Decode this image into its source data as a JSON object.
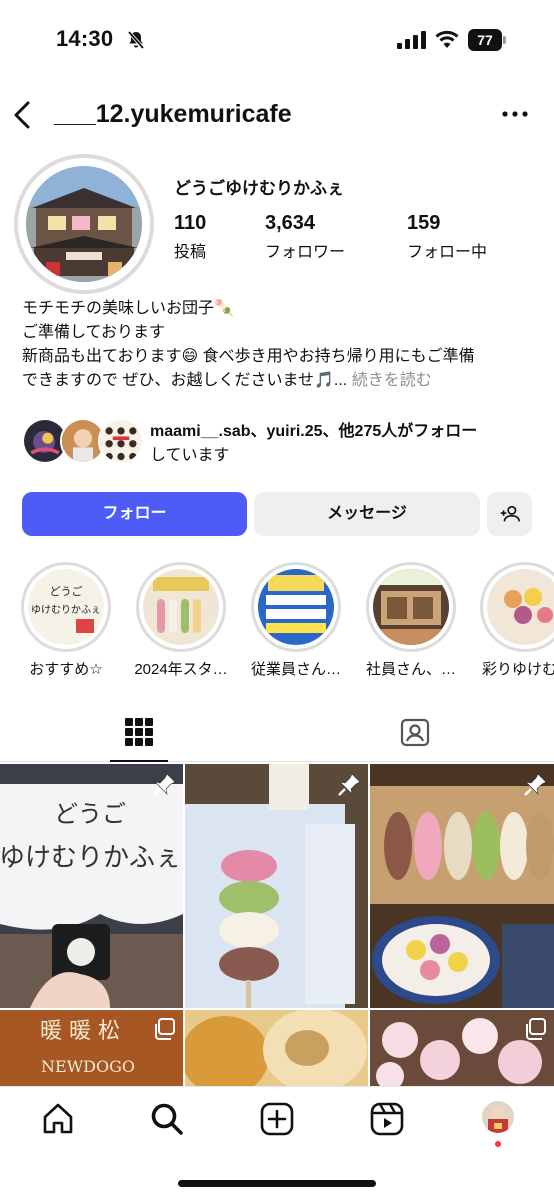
{
  "status_bar": {
    "time": "14:30",
    "battery": "77"
  },
  "header": {
    "username": "___12.yukemuricafe"
  },
  "profile": {
    "display_name": "どうごゆけむりかふぇ",
    "stats": [
      {
        "value": "110",
        "label": "投稿"
      },
      {
        "value": "3,634",
        "label": "フォロワー"
      },
      {
        "value": "159",
        "label": "フォロー中"
      }
    ],
    "bio_lines": [
      "モチモチの美味しいお団子🍡",
      "ご準備しております",
      "新商品も出ております😄 食べ歩き用やお持ち帰り用にもご準備",
      "できますので ぜひ、お越しくださいませ🎵..."
    ],
    "bio_more": "続きを読む"
  },
  "mutual": {
    "line1_names": "maami__.sab、yuiri.25、他275人がフォロー",
    "line2": "しています"
  },
  "actions": {
    "follow": "フォロー",
    "message": "メッセージ"
  },
  "highlights": [
    {
      "label": "おすすめ☆"
    },
    {
      "label": "2024年スタ…"
    },
    {
      "label": "従業員さん…"
    },
    {
      "label": "社員さん、…"
    },
    {
      "label": "彩りゆけむ"
    }
  ],
  "highlight_texts": {
    "h1_line1": "どうご",
    "h1_line2": "ゆけむりかふぇ"
  },
  "grid_texts": {
    "post1_line1": "どうご",
    "post1_line2": "ゆけむりかふぇ",
    "post4_line1": "暖 暖 松",
    "post4_line2": "NEWDOGO"
  },
  "colors": {
    "follow_button": "#4d5cf5",
    "notification_dot": "#ff3040"
  }
}
